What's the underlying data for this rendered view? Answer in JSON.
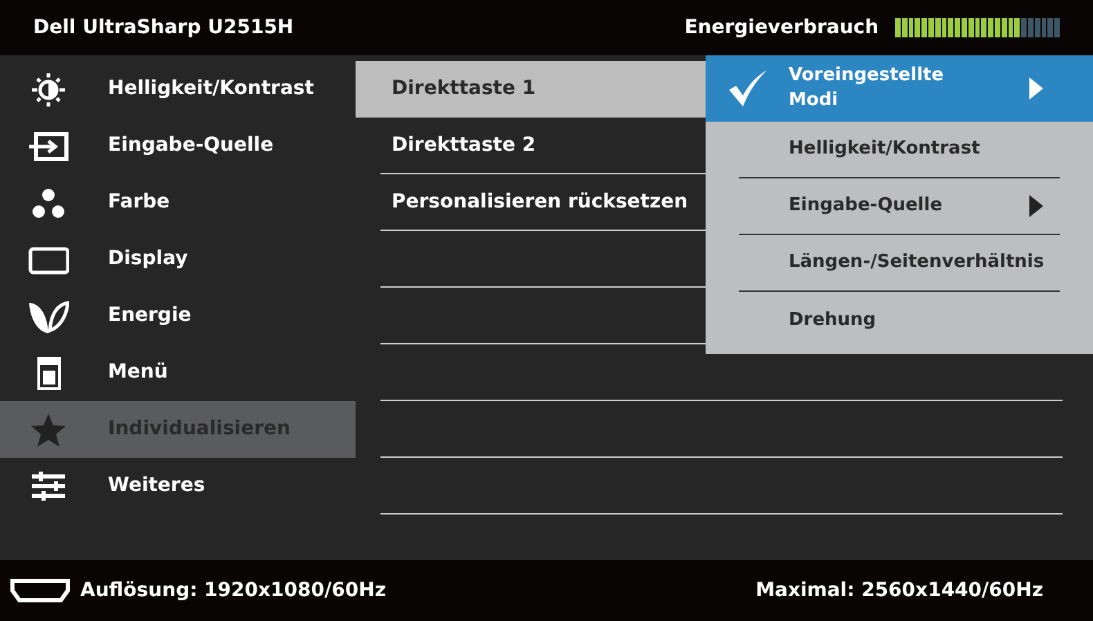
{
  "header": {
    "title": "Dell UltraSharp U2515H",
    "energy_label": "Energieverbrauch",
    "energy": {
      "level": 0.75
    }
  },
  "menu": [
    {
      "kind": "sun",
      "label": "Helligkeit/Kontrast",
      "selected": false
    },
    {
      "kind": "input",
      "label": "Eingabe-Quelle",
      "selected": false
    },
    {
      "kind": "dots",
      "label": "Farbe",
      "selected": false
    },
    {
      "kind": "display",
      "label": "Display",
      "selected": false
    },
    {
      "kind": "leaf",
      "label": "Energie",
      "selected": false
    },
    {
      "kind": "menu",
      "label": "Menü",
      "selected": false
    },
    {
      "kind": "star",
      "label": "Individualisieren",
      "selected": true
    },
    {
      "kind": "sliders",
      "label": "Weiteres",
      "selected": false
    }
  ],
  "submenu": [
    {
      "label": "Direkttaste 1",
      "selected": true
    },
    {
      "label": "Direkttaste 2",
      "selected": false
    },
    {
      "label": "Personalisieren rücksetzen",
      "selected": false
    }
  ],
  "popup": [
    {
      "label": "Voreingestellte Modi",
      "selected": true,
      "checked": true,
      "has_submenu": true
    },
    {
      "label": "Helligkeit/Kontrast",
      "selected": false,
      "checked": false,
      "has_submenu": false
    },
    {
      "label": "Eingabe-Quelle",
      "selected": false,
      "checked": false,
      "has_submenu": true
    },
    {
      "label": "Längen-/Seitenverhältnis",
      "selected": false,
      "checked": false,
      "has_submenu": false
    },
    {
      "label": "Drehung",
      "selected": false,
      "checked": false,
      "has_submenu": false
    }
  ],
  "footer": {
    "resolution": "Auflösung: 1920x1080/60Hz",
    "maximum": "Maximal: 2560x1440/60Hz"
  }
}
